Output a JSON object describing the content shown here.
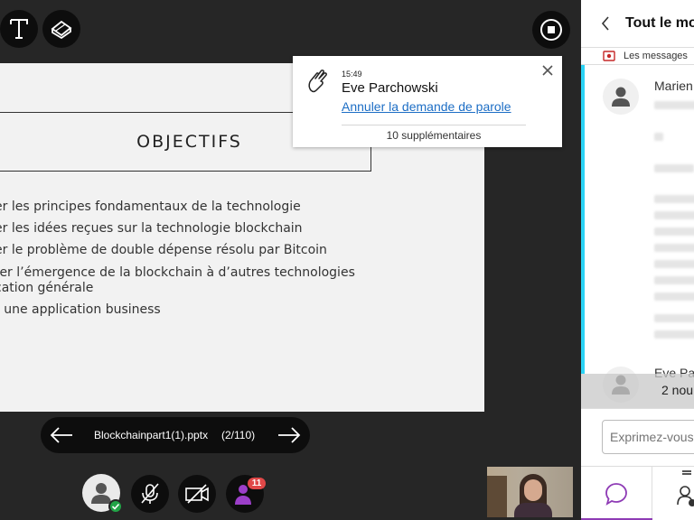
{
  "slide": {
    "title": "OBJECTIFS",
    "bullets": [
      "er les principes fondamentaux de la technologie",
      "er les idées reçues sur la technologie blockchain",
      "er le problème de double dépense résolu par Bitcoin",
      "rer  l’émergence  de  la  blockchain  à  d’autres  technologies",
      "cation générale",
      "r une application business"
    ]
  },
  "notification": {
    "time": "15:49",
    "name": "Eve Parchowski",
    "action_link": "Annuler la demande de parole",
    "more": "10 supplémentaires"
  },
  "presentation": {
    "filename": "Blockchainpart1(1).pptx",
    "page": "(2/110)"
  },
  "controls": {
    "raise_hand_badge": "11"
  },
  "chat_panel": {
    "title": "Tout le mo",
    "recording_notice": "Les messages",
    "message_author_1": "Marien",
    "message_author_2": "Eve Pa",
    "new_messages": "2 nou",
    "input_placeholder": "Exprimez-vous"
  },
  "colors": {
    "accent_cyan": "#2bd3f5",
    "link_blue": "#1d6ec5",
    "badge_red": "#e04848",
    "hand_purple": "#9c3fc9",
    "chat_icon_purple": "#8e3bb5",
    "status_green": "#22a447"
  }
}
